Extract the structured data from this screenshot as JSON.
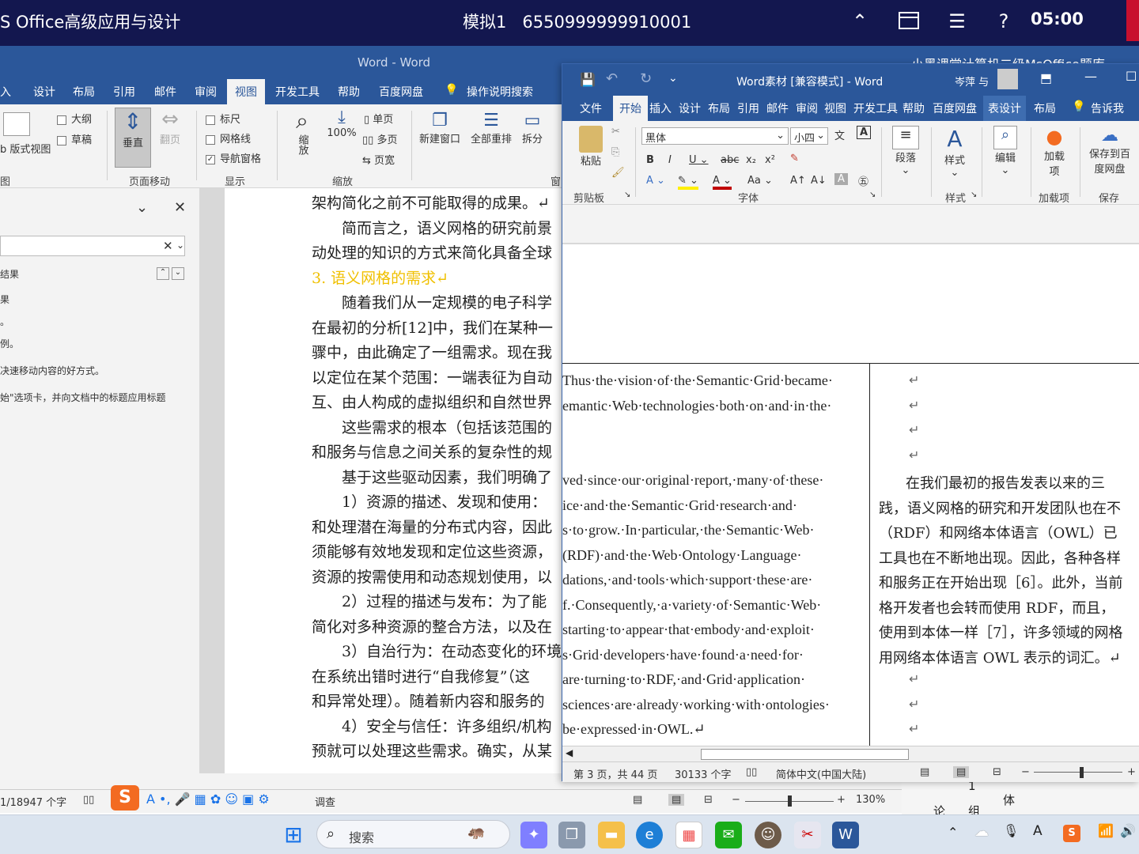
{
  "exam_bar": {
    "title": "S Office高级应用与设计",
    "session": "模拟1",
    "ticket": "6550999999910001",
    "clock": "05:00",
    "icons": [
      "collapse-icon",
      "window-icon",
      "list-icon",
      "help-icon"
    ]
  },
  "word_back": {
    "title": "Word - Word",
    "tabs": [
      "入",
      "设计",
      "布局",
      "引用",
      "邮件",
      "审阅",
      "视图",
      "开发工具",
      "帮助",
      "百度网盘"
    ],
    "tell_me": "操作说明搜索",
    "ribbon": {
      "web_layout": "b 版式视图",
      "outline": "大纲",
      "draft": "草稿",
      "vertical": "垂直",
      "side_to_side": "翻页",
      "page_move": "页面移动",
      "ruler": "标尺",
      "gridlines": "网格线",
      "nav_pane": "导航窗格",
      "show": "显示",
      "zoom": "缩放",
      "zoom100": "100%",
      "one_page": "单页",
      "multi_page": "多页",
      "page_width": "页宽",
      "zoom_group": "缩放",
      "new_window": "新建窗口",
      "arrange_all": "全部重排",
      "split": "拆分",
      "win_group": "窗",
      "left_group": "图"
    },
    "nav_pane": {
      "result_label": "结果",
      "item2": "果",
      "item3": "。",
      "hint1": "例。",
      "hint2": "决速移动内容的好方式。",
      "hint3": "始\"选项卡，并向文档中的标题应用标题"
    },
    "doc_lines": [
      "架构简化之前不可能取得的成果。↵",
      "　　简而言之，语义网格的研究前景",
      "动处理的知识的方式来简化具备全球",
      "3. 语义网格的需求↵",
      "　　随着我们从一定规模的电子科学",
      "在最初的分析[12]中，我们在某种一",
      "骤中，由此确定了一组需求。现在我",
      "以定位在某个范围：一端表征为自动",
      "互、由人构成的虚拟组织和自然世界",
      "　　这些需求的根本（包括该范围的",
      "和服务与信息之间关系的复杂性的规",
      "　　基于这些驱动因素，我们明确了",
      "　　1）资源的描述、发现和使用：",
      "和处理潜在海量的分布式内容，因此",
      "须能够有效地发现和定位这些资源，",
      "资源的按需使用和动态规划使用，以",
      "　　2）过程的描述与发布：为了能",
      "简化对多种资源的整合方法，以及在",
      "　　3）自治行为：在动态变化的环境",
      "在系统出错时进行“自我修复”（这",
      "和异常处理）。随着新内容和服务的",
      "　　4）安全与信任：许多组织/机构",
      "预就可以处理这些需求。确实，从某"
    ],
    "status": {
      "words": "1/18947 个字",
      "zoom": "130%",
      "proofing": "调查"
    }
  },
  "word_front": {
    "title": "Word素材 [兼容模式] - Word",
    "user": "岑萍 与",
    "tabs": [
      "文件",
      "开始",
      "插入",
      "设计",
      "布局",
      "引用",
      "邮件",
      "审阅",
      "视图",
      "开发工具",
      "帮助",
      "百度网盘",
      "表设计",
      "布局",
      "告诉我"
    ],
    "ribbon": {
      "font": "黑体",
      "size": "小四",
      "paste": "粘贴",
      "clipboard": "剪贴板",
      "font_group": "字体",
      "paragraph": "段落",
      "styles": "样式",
      "styles_group": "样式",
      "editing": "编辑",
      "addins": "加载项",
      "addin_btn": "加载项",
      "save_baidu": "保存到百度网盘",
      "save_group": "保存"
    },
    "en_lines": [
      "Thus·the·vision·of·the·Semantic·Grid·became·",
      "emantic·Web·technologies·both·on·and·in·the·",
      "ved·since·our·original·report,·many·of·these·",
      "ice·and·the·Semantic·Grid·research·and·",
      "s·to·grow.·In·particular,·the·Semantic·Web·",
      "(RDF)·and·the·Web·Ontology·Language·",
      "dations,·and·tools·which·support·these·are·",
      "f.·Consequently,·a·variety·of·Semantic·Web·",
      "starting·to·appear·that·embody·and·exploit·",
      "s·Grid·developers·have·found·a·need·for·",
      "are·turning·to·RDF,·and·Grid·application·",
      "sciences·are·already·working·with·ontologies·",
      "be·expressed·in·OWL.↵"
    ],
    "zh_lines": [
      "在我们最初的报告发表以来的三",
      "践，语义网格的研究和开发团队也在不",
      "（RDF）和网络本体语言（OWL）已",
      "工具也在不断地出现。因此，各种各样",
      "和服务正在开始出现［6］。此外，当前",
      "格开发者也会转而使用 RDF，而且，",
      "使用到本体一样［7］，许多领域的网格",
      "用网络本体语言 OWL 表示的词汇。↵"
    ],
    "marks": [
      "↵",
      "↵",
      "↵",
      "↵",
      "↵",
      "↵",
      "↵"
    ],
    "status": {
      "page": "第 3 页，共 44 页",
      "words": "30133 个字",
      "lang": "简体中文(中国大陆)"
    }
  },
  "side_window": {
    "title": "小黑课堂计算机二级MsOffice题库",
    "cells": [
      "1",
      "体",
      "论",
      "组"
    ]
  },
  "taskbar": {
    "search": "搜索",
    "time_icons": [
      "chevron-up-icon",
      "cloud-icon",
      "mic-icon",
      "font-icon",
      "sogou-icon",
      "wifi-icon"
    ]
  }
}
